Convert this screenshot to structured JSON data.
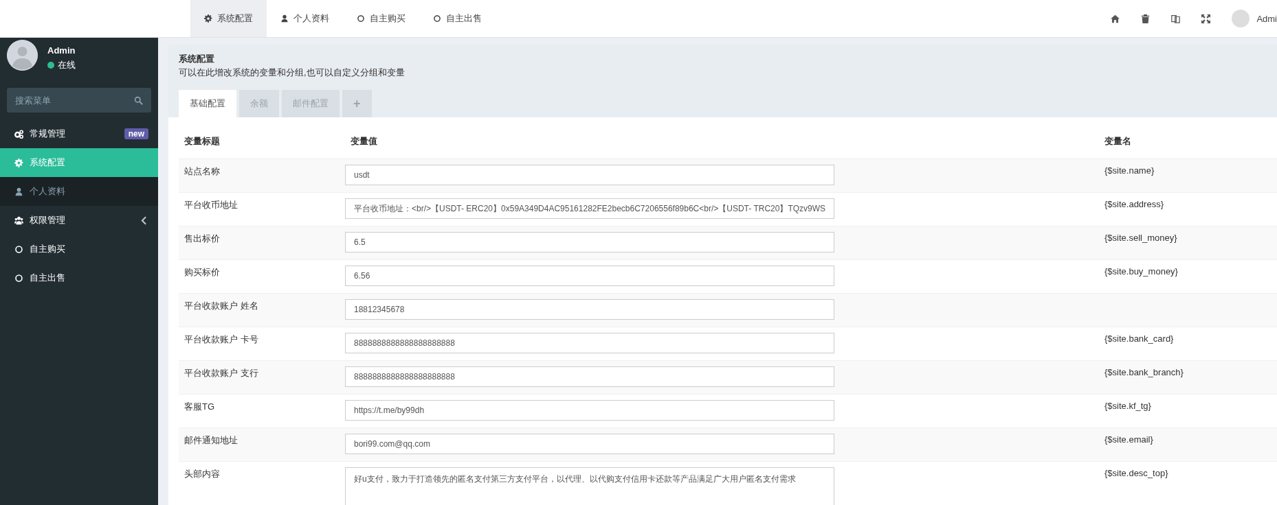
{
  "topnav": {
    "tabs": [
      {
        "label": "系统配置",
        "selected": true
      },
      {
        "label": "个人资料",
        "selected": false
      },
      {
        "label": "自主购买",
        "selected": false
      },
      {
        "label": "自主出售",
        "selected": false
      }
    ],
    "user": "Admi"
  },
  "sidebar": {
    "user": {
      "name": "Admin",
      "status": "在线"
    },
    "search": {
      "placeholder": "搜索菜单"
    },
    "menu": [
      {
        "kind": "group",
        "label": "常规管理",
        "badge": "new",
        "expanded": true,
        "children": [
          {
            "label": "系统配置",
            "selected": true
          },
          {
            "label": "个人资料",
            "selected": false
          }
        ]
      },
      {
        "kind": "group",
        "label": "权限管理",
        "expanded": false
      },
      {
        "kind": "link",
        "label": "自主购买",
        "selected": false
      },
      {
        "kind": "link",
        "label": "自主出售",
        "selected": false
      }
    ]
  },
  "panel": {
    "title": "系统配置",
    "description": "可以在此增改系统的变量和分组,也可以自定义分组和变量",
    "tabs": [
      {
        "kind": "tab",
        "label": "基础配置",
        "selected": true
      },
      {
        "kind": "tab",
        "label": "余额",
        "selected": false
      },
      {
        "kind": "tab",
        "label": "邮件配置",
        "selected": false
      },
      {
        "kind": "add",
        "label": "+",
        "selected": false
      }
    ],
    "table": {
      "columns": [
        "变量标题",
        "变量值",
        "变量名"
      ],
      "rows": [
        {
          "kind": "input",
          "title": "站点名称",
          "value": "usdt",
          "name": "{$site.name}"
        },
        {
          "kind": "input",
          "title": "平台收币地址",
          "value": "平台收币地址：<br/>【USDT- ERC20】0x59A349D4AC95161282FE2becb6C7206556f89b6C<br/>【USDT- TRC20】TQzv9WS",
          "name": "{$site.address}"
        },
        {
          "kind": "input",
          "title": "售出标价",
          "value": "6.5",
          "name": "{$site.sell_money}"
        },
        {
          "kind": "input",
          "title": "购买标价",
          "value": "6.56",
          "name": "{$site.buy_money}"
        },
        {
          "kind": "input",
          "title": "平台收款账户 姓名",
          "value": "18812345678"
        },
        {
          "kind": "input",
          "title": "平台收款账户 卡号",
          "value": "8888888888888888888888",
          "name": "{$site.bank_card}"
        },
        {
          "kind": "input",
          "title": "平台收款账户 支行",
          "value": "8888888888888888888888",
          "name": "{$site.bank_branch}"
        },
        {
          "kind": "input",
          "title": "客服TG",
          "value": "https://t.me/by99dh",
          "name": "{$site.kf_tg}"
        },
        {
          "kind": "input",
          "title": "邮件通知地址",
          "value": "bori99.com@qq.com",
          "name": "{$site.email}"
        },
        {
          "kind": "textarea",
          "title": "头部内容",
          "value": "好u支付，致力于打造领先的匿名支付第三方支付平台，以代理、以代购支付信用卡还款等产品满足广大用户匿名支付需求",
          "name": "{$site.desc_top}"
        }
      ]
    }
  }
}
